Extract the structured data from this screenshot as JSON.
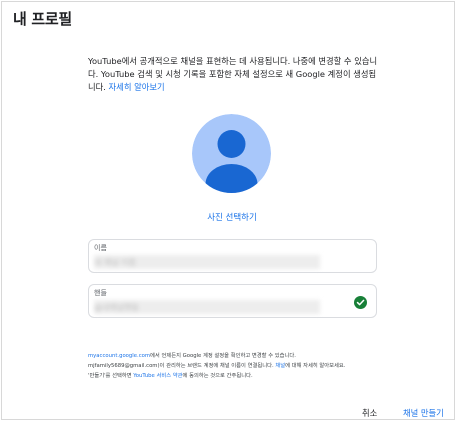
{
  "dialog": {
    "title": "내 프로필"
  },
  "intro": {
    "text": "YouTube에서 공개적으로 채널을 표현하는 데 사용됩니다. 나중에 변경할 수 있습니다. YouTube 검색 및 시청 기록을 포함한 자체 설정으로 새 Google 계정이 생성됩니다.",
    "learn_more": "자세히 알아보기"
  },
  "avatar": {
    "icon": "default-profile-avatar",
    "bg_color": "#a8c7fa",
    "figure_color": "#1967d2"
  },
  "photo_link": "사진 선택하기",
  "name_field": {
    "label": "이름",
    "value": "내 채널 이름"
  },
  "handle_field": {
    "label": "핸들",
    "value": "@내채널핸들",
    "status_icon": "check-circle-icon",
    "status_color": "#188038"
  },
  "footer": {
    "link1": "myaccount.google.com",
    "text1": "에서 언제든지 Google 계정 설정을 확인하고 변경할 수 있습니다.",
    "email": "mjfamily5689@gmail.com",
    "text2": ")이 관리하는 브랜드 계정에 채널 이름이 연결됩니다.",
    "link2": "채널",
    "text3": "에 대해 자세히 알아보세요.",
    "text4": "'만들기'를 선택하면 ",
    "link3": "YouTube 서비스 약관",
    "text5": "에 동의하는 것으로 간주됩니다."
  },
  "actions": {
    "cancel": "취소",
    "create": "채널 만들기"
  }
}
